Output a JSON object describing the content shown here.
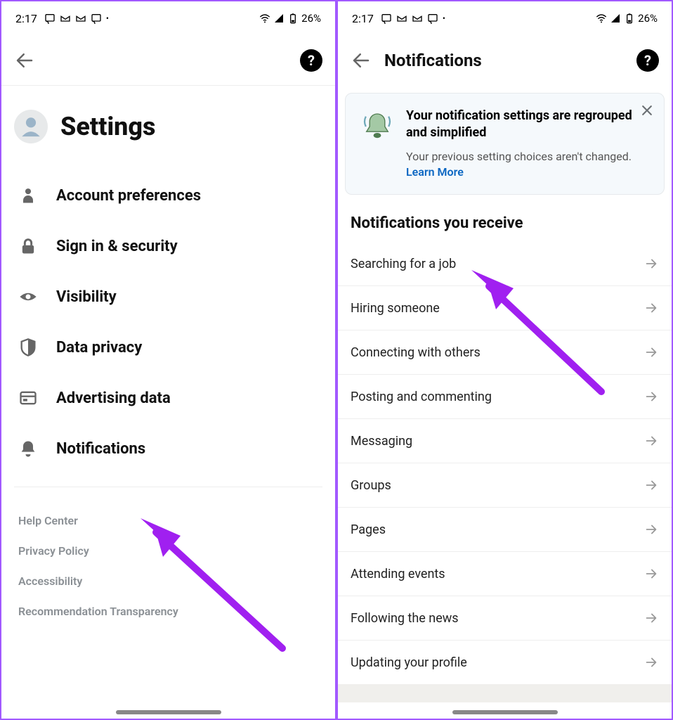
{
  "status": {
    "time": "2:17",
    "battery": "26%"
  },
  "screen1": {
    "title": "Settings",
    "menu": [
      {
        "label": "Account preferences"
      },
      {
        "label": "Sign in & security"
      },
      {
        "label": "Visibility"
      },
      {
        "label": "Data privacy"
      },
      {
        "label": "Advertising data"
      },
      {
        "label": "Notifications"
      }
    ],
    "footer": [
      "Help Center",
      "Privacy Policy",
      "Accessibility",
      "Recommendation Transparency"
    ]
  },
  "screen2": {
    "header": "Notifications",
    "info": {
      "title": "Your notification settings are regrouped and simplified",
      "sub": "Your previous setting choices aren't changed.",
      "learn": "Learn More"
    },
    "section": "Notifications you receive",
    "items": [
      "Searching for a job",
      "Hiring someone",
      "Connecting with others",
      "Posting and commenting",
      "Messaging",
      "Groups",
      "Pages",
      "Attending events",
      "Following the news",
      "Updating your profile"
    ]
  }
}
